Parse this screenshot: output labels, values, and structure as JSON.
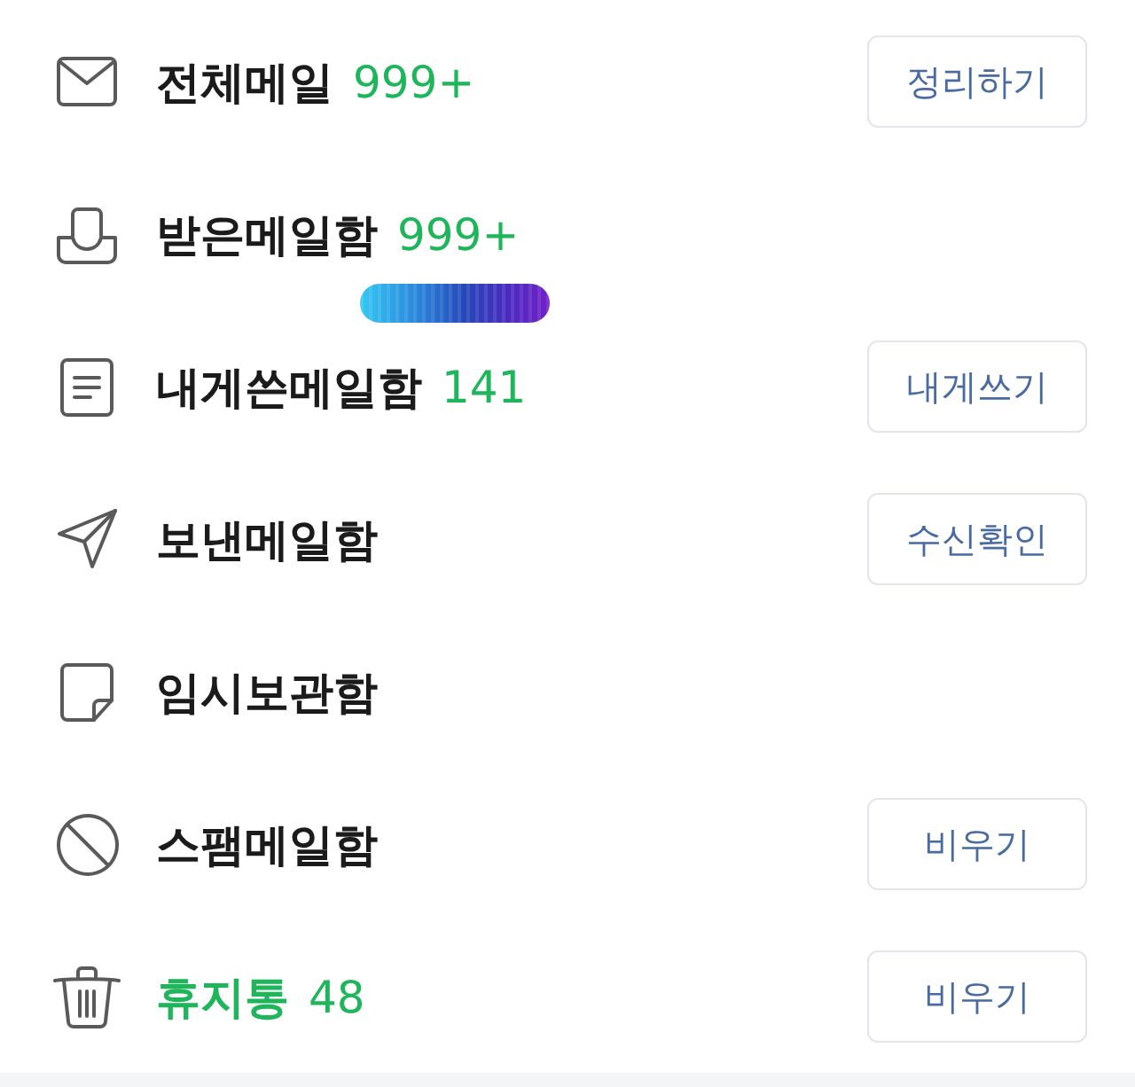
{
  "folders": [
    {
      "label": "전체메일",
      "count": "999+",
      "selected": false,
      "marker": false,
      "action": "정리하기"
    },
    {
      "label": "받은메일함",
      "count": "999+",
      "selected": false,
      "marker": true
    },
    {
      "label": "내게쓴메일함",
      "count": "141",
      "selected": false,
      "marker": false,
      "action": "내게쓰기"
    },
    {
      "label": "보낸메일함",
      "selected": false,
      "marker": false,
      "action": "수신확인"
    },
    {
      "label": "임시보관함",
      "selected": false,
      "marker": false
    },
    {
      "label": "스팸메일함",
      "selected": false,
      "marker": false,
      "action": "비우기"
    },
    {
      "label": "휴지통",
      "count": "48",
      "selected": true,
      "marker": false,
      "action": "비우기"
    }
  ]
}
